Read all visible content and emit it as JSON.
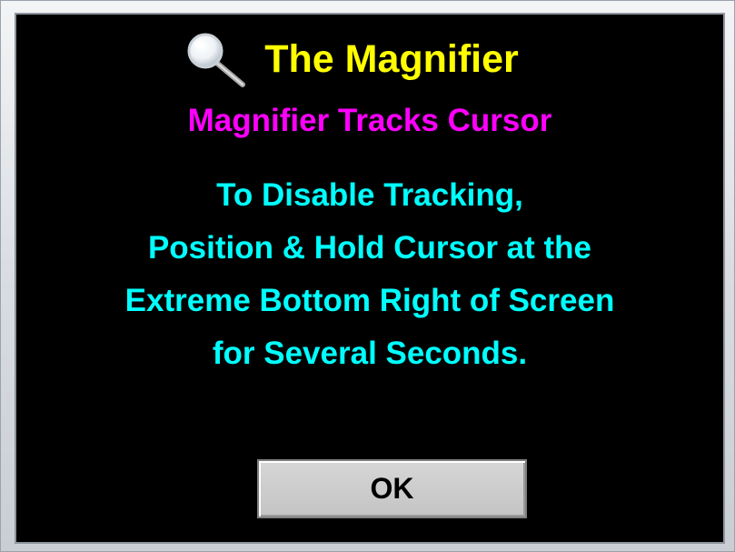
{
  "dialog": {
    "title": "The Magnifier",
    "title_icon": "magnifier-icon",
    "subtitle": "Magnifier Tracks Cursor",
    "instructions": [
      "To Disable Tracking,",
      "Position & Hold Cursor at the",
      "Extreme Bottom Right of Screen",
      "for Several Seconds."
    ],
    "ok_label": "OK"
  },
  "colors": {
    "background": "#000000",
    "title": "#ffff00",
    "subtitle": "#ff00ff",
    "instructions": "#00ffff",
    "button_face": "#c8c8c8"
  }
}
